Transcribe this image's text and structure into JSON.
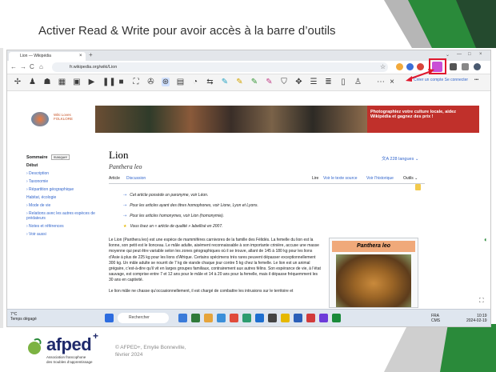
{
  "slide": {
    "title": "Activer Read & Write pour avoir accès à la barre d’outils",
    "footer_logo": "afped",
    "footer_logo_plus": "+",
    "footer_logo_sub_1": "Association francophone",
    "footer_logo_sub_2": "des troubles d’apprentissage",
    "copyright_1": "© AFPED+, Emylie Bonneville,",
    "copyright_2": "février 2024",
    "colors": {
      "accent_green": "#2a8a3a",
      "dark_green": "#244a2e",
      "gray_panel": "#cfcfcf",
      "highlight_red": "#e0192d",
      "brand_navy": "#1f2a6b"
    }
  },
  "browser": {
    "tab_title": "Lion — Wikipédia",
    "tab_close": "×",
    "new_tab": "+",
    "window_controls": [
      "⌄",
      "—",
      "□",
      "×"
    ],
    "nav": {
      "back": "←",
      "forward": "→",
      "reload": "C",
      "home": "⌂"
    },
    "url": "fr.wikipedia.org/wiki/Lion",
    "bookmark_star": "☆",
    "login_link": "Créer un compte  Se connecter",
    "menu_dots": "•••"
  },
  "readwrite_toolbar": {
    "icons": [
      {
        "name": "drag-handle-icon",
        "glyph": "✢"
      },
      {
        "name": "dictionary-icon",
        "glyph": "♟"
      },
      {
        "name": "picture-dictionary-icon",
        "glyph": "☗"
      },
      {
        "name": "book-icon",
        "glyph": "▦"
      },
      {
        "name": "screen-icon",
        "glyph": "▣"
      },
      {
        "name": "play-icon",
        "glyph": "▶"
      },
      {
        "name": "pause-icon",
        "glyph": "❚❚"
      },
      {
        "name": "stop-icon",
        "glyph": "■"
      },
      {
        "name": "screenshot-reader-icon",
        "glyph": "⛶"
      },
      {
        "name": "audio-maker-icon",
        "glyph": "✇"
      },
      {
        "name": "hover-speech-icon",
        "glyph": "⊛"
      },
      {
        "name": "screen-mask-icon",
        "glyph": "▤"
      },
      {
        "name": "talk-and-type-icon",
        "glyph": "◔"
      },
      {
        "name": "translator-icon",
        "glyph": "⇆"
      },
      {
        "name": "highlight-cyan-icon",
        "glyph": "✎"
      },
      {
        "name": "highlight-yellow-icon",
        "glyph": "✎"
      },
      {
        "name": "highlight-green-icon",
        "glyph": "✎"
      },
      {
        "name": "highlight-pink-icon",
        "glyph": "✎"
      },
      {
        "name": "collect-highlights-icon",
        "glyph": "⛉"
      },
      {
        "name": "simplify-icon",
        "glyph": "✥"
      },
      {
        "name": "vocabulary-icon",
        "glyph": "☰"
      },
      {
        "name": "check-it-icon",
        "glyph": "≣"
      },
      {
        "name": "voice-note-icon",
        "glyph": "▯"
      },
      {
        "name": "practice-reading-icon",
        "glyph": "♙"
      },
      {
        "name": "more-icon",
        "glyph": "⋯"
      },
      {
        "name": "close-icon",
        "glyph": "×"
      }
    ]
  },
  "wiki": {
    "banner_logo_text_1": "Wiki Loves",
    "banner_logo_text_2": "FOLKLORE",
    "banner_promo": "Photographiez votre culture locale, aidez Wikipédia et gagnez des prix !",
    "page_title": "Lion",
    "page_subtitle": "Panthera leo",
    "languages": "文A 228 langues ⌄",
    "tabs": {
      "article": "Article",
      "discussion": "Discussion",
      "read": "Lire",
      "edit_source": "Voir le texte source",
      "history": "Voir l’historique",
      "tools": "Outils ⌄"
    },
    "sidebar": {
      "heading": "Sommaire",
      "hide": "masquer",
      "items": [
        "Début",
        "› Description",
        "› Taxonomie",
        "› Répartition géographique",
        "Habitat, écologie",
        "› Mode de vie",
        "› Relations avec les autres espèces de prédateurs",
        "› Notes et références",
        "› Voir aussi"
      ]
    },
    "hatnotes": [
      "Cet article possède un paronyme, voir Léon.",
      "Pour les articles ayant des titres homophones, voir Lione, Lyon et Lyons.",
      "Pour les articles homonymes, voir Lion (homonymie).",
      "Vous lisez un « article de qualité » labellisé en 2007."
    ],
    "body": "Le Lion (Panthera leo) est une espèce de mammifères carnivores de la famille des Félidés. La femelle du lion est la lionne, son petit est le lionceau. Le mâle adulte, aisément reconnaissable à son importante crinière, accuse une masse moyenne qui peut être variable selon les zones géographiques où il se trouve, allant de 145 à 180 kg pour les lions d’Asie à plus de 225 kg pour les lions d’Afrique. Certains spécimens très rares peuvent dépasser exceptionnellement 300 kg. Un mâle adulte se nourrit de 7 kg de viande chaque jour contre 5 kg chez la femelle. Le lion est un animal grégaire, c’est-à-dire qu’il vit en larges groupes familiaux, contrairement aux autres félins. Son espérance de vie, à l’état sauvage, est comprise entre 7 et 12 ans pour le mâle et 14 à 20 ans pour la femelle, mais il dépasse fréquemment les 30 ans en captivité.",
    "body_more": "Le lion mâle ne chasse qu’occasionnellement, il est chargé de combattre les intrusions sur le territoire et",
    "infobox_title": "Panthera leo"
  },
  "taskbar": {
    "weather_temp": "7°C",
    "weather_desc": "Temps dégagé",
    "search": "Rechercher",
    "lang_1": "FRA",
    "lang_2": "CMS",
    "time": "10:19",
    "date": "2024-02-19"
  }
}
